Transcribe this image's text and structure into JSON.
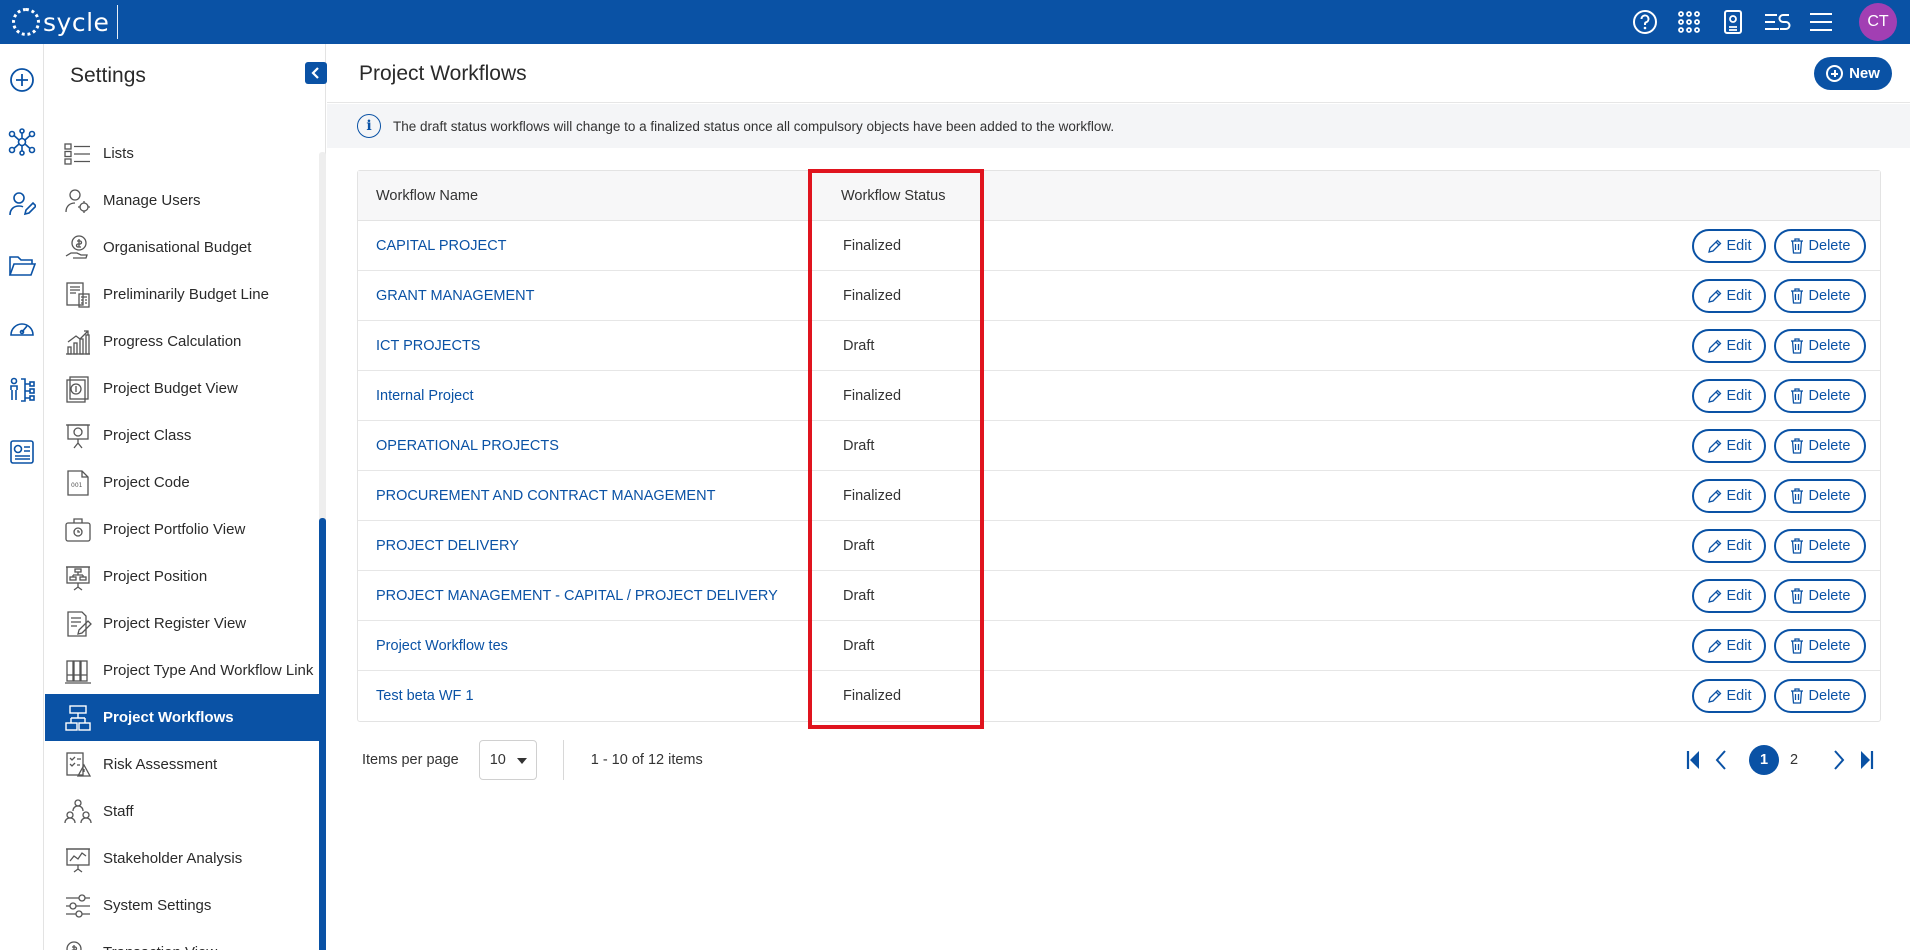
{
  "app": {
    "logo_text": "sycle",
    "avatar_initials": "CT"
  },
  "topbar": {
    "icons": [
      "help-icon",
      "apps-grid-icon",
      "report-icon",
      "filter-list-icon",
      "hamburger-menu-icon"
    ]
  },
  "rail": {
    "icons": [
      "add-circle-icon",
      "network-icon",
      "user-edit-icon",
      "folder-icon",
      "dashboard-gauge-icon",
      "org-chart-icon",
      "report-card-icon"
    ]
  },
  "settings": {
    "title": "Settings",
    "items": [
      {
        "label": "Lists",
        "icon": "list-icon"
      },
      {
        "label": "Manage Users",
        "icon": "user-gear-icon"
      },
      {
        "label": "Organisational Budget",
        "icon": "budget-hand-icon"
      },
      {
        "label": "Preliminarily Budget Line",
        "icon": "calculator-doc-icon"
      },
      {
        "label": "Progress Calculation",
        "icon": "bar-growth-icon"
      },
      {
        "label": "Project Budget View",
        "icon": "budget-view-icon"
      },
      {
        "label": "Project Class",
        "icon": "presentation-icon"
      },
      {
        "label": "Project Code",
        "icon": "code-doc-icon"
      },
      {
        "label": "Project Portfolio View",
        "icon": "briefcase-icon"
      },
      {
        "label": "Project Position",
        "icon": "hierarchy-board-icon"
      },
      {
        "label": "Project Register View",
        "icon": "register-edit-icon"
      },
      {
        "label": "Project Type And Workflow Link",
        "icon": "binders-icon"
      },
      {
        "label": "Project Workflows",
        "icon": "workflow-icon",
        "active": true
      },
      {
        "label": "Risk Assessment",
        "icon": "risk-checklist-icon"
      },
      {
        "label": "Staff",
        "icon": "staff-icon"
      },
      {
        "label": "Stakeholder Analysis",
        "icon": "analysis-board-icon"
      },
      {
        "label": "System Settings",
        "icon": "sliders-icon"
      },
      {
        "label": "Transaction View",
        "icon": "transaction-icon"
      }
    ]
  },
  "main": {
    "title": "Project Workflows",
    "new_label": "New",
    "info_text": "The draft status workflows will change to a finalized status once all compulsory objects have been added to the workflow.",
    "columns": {
      "name": "Workflow Name",
      "status": "Workflow Status"
    },
    "edit_label": "Edit",
    "delete_label": "Delete",
    "rows": [
      {
        "name": "CAPITAL PROJECT",
        "status": "Finalized"
      },
      {
        "name": "GRANT MANAGEMENT",
        "status": "Finalized"
      },
      {
        "name": "ICT PROJECTS",
        "status": "Draft"
      },
      {
        "name": "Internal Project",
        "status": "Finalized"
      },
      {
        "name": "OPERATIONAL PROJECTS",
        "status": "Draft"
      },
      {
        "name": "PROCUREMENT AND CONTRACT MANAGEMENT",
        "status": "Finalized"
      },
      {
        "name": "PROJECT DELIVERY",
        "status": "Draft"
      },
      {
        "name": "PROJECT MANAGEMENT - CAPITAL / PROJECT DELIVERY",
        "status": "Draft"
      },
      {
        "name": "Project Workflow tes",
        "status": "Draft"
      },
      {
        "name": "Test beta WF 1",
        "status": "Finalized"
      }
    ],
    "pager": {
      "items_per_page_label": "Items per page",
      "items_per_page": "10",
      "range_text": "1 - 10 of 12 items",
      "pages": [
        "1",
        "2"
      ],
      "current_page": "1"
    }
  },
  "colors": {
    "brand": "#0a52a5",
    "avatar": "#a23fb3",
    "highlight": "#e0141e"
  }
}
